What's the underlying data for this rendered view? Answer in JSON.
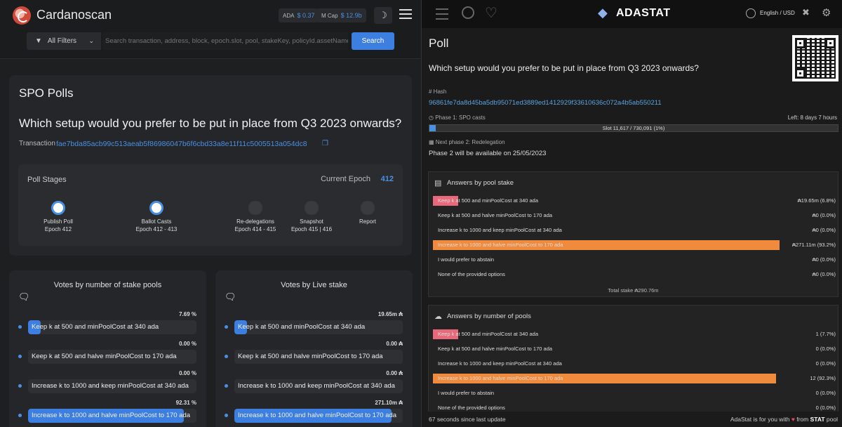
{
  "left": {
    "app_title": "Cardanoscan",
    "ada_label": "ADA",
    "ada_price": "$ 0.37",
    "mcap_label": "M Cap",
    "mcap_value": "$ 12.9b",
    "filter_label": "All Filters",
    "search_placeholder": "Search transaction, address, block, epoch.slot, pool, stakeKey, policyId.assetName",
    "search_button": "Search",
    "page_title": "SPO Polls",
    "question": "Which setup would you prefer to be put in place from Q3 2023 onwards?",
    "tx_label": "Transaction",
    "tx_hash": "fae7bda85acb99c513aeab5f86986047b6f6cbd33a8e11f11c5005513a054dc8",
    "stages_title": "Poll Stages",
    "current_epoch_label": "Current Epoch",
    "current_epoch": "412",
    "stages": [
      {
        "name": "Publish Poll",
        "epoch": "Epoch 412",
        "active": true
      },
      {
        "name": "Ballot Casts",
        "epoch": "Epoch 412 - 413",
        "active": true
      },
      {
        "name": "Re-delegations",
        "epoch": "Epoch 414 - 415",
        "active": false
      },
      {
        "name": "Snapshot",
        "epoch": "Epoch 415 | 416",
        "active": false
      },
      {
        "name": "Report",
        "epoch": "",
        "active": false
      }
    ],
    "votes_pools": {
      "title": "Votes by number of stake pools",
      "rows": [
        {
          "label": "Keep k at 500 and minPoolCost at 340 ada",
          "value": "7.69 %",
          "fraction": 0.0769
        },
        {
          "label": "Keep k at 500 and halve minPoolCost to 170 ada",
          "value": "0.00 %",
          "fraction": 0
        },
        {
          "label": "Increase k to 1000 and keep minPoolCost at 340 ada",
          "value": "0.00 %",
          "fraction": 0
        },
        {
          "label": "Increase k to 1000 and halve minPoolCost to 170 ada",
          "value": "92.31 %",
          "fraction": 0.9231
        }
      ]
    },
    "votes_stake": {
      "title": "Votes by Live stake",
      "rows": [
        {
          "label": "Keep k at 500 and minPoolCost at 340 ada",
          "value": "19.65m ₳",
          "fraction": 0.068
        },
        {
          "label": "Keep k at 500 and halve minPoolCost to 170 ada",
          "value": "0.00 ₳",
          "fraction": 0
        },
        {
          "label": "Increase k to 1000 and keep minPoolCost at 340 ada",
          "value": "0.00 ₳",
          "fraction": 0
        },
        {
          "label": "Increase k to 1000 and halve minPoolCost to 170 ada",
          "value": "271.10m ₳",
          "fraction": 0.932
        }
      ]
    }
  },
  "right": {
    "brand": "ADASTAT",
    "language": "English / USD",
    "page_title": "Poll",
    "question": "Which setup would you prefer to be put in place from Q3 2023 onwards?",
    "hash_label": "Hash",
    "hash": "96861fe7da8d45ba5db95071ed3889ed1412929f33610636c072a4b5ab550211",
    "phase1_label": "Phase 1: SPO casts",
    "time_left": "Left: 8 days 7 hours",
    "slot_text": "Slot 11,617 / 730,091 (1%)",
    "slot_fraction": 0.016,
    "phase2_label": "Next phase 2: Redelegation",
    "phase2_text": "Phase 2 will be available on 25/05/2023",
    "stake_panel": {
      "title": "Answers by pool stake",
      "rows": [
        {
          "label": "Keep k at 500 and minPoolCost at 340 ada",
          "value": "₳19.65m (6.8%)",
          "fraction": 0.068,
          "color": "#e8697a"
        },
        {
          "label": "Keep k at 500 and halve minPoolCost to 170 ada",
          "value": "₳0 (0.0%)",
          "fraction": 0,
          "color": "#e8697a"
        },
        {
          "label": "Increase k to 1000 and keep minPoolCost at 340 ada",
          "value": "₳0 (0.0%)",
          "fraction": 0,
          "color": "#e8697a"
        },
        {
          "label": "Increase k to 1000 and halve minPoolCost to 170 ada",
          "value": "₳271.11m (93.2%)",
          "fraction": 0.932,
          "color": "#f08a3c"
        },
        {
          "label": "I would prefer to abstain",
          "value": "₳0 (0.0%)",
          "fraction": 0,
          "color": "#e8697a"
        },
        {
          "label": "None of the provided options",
          "value": "₳0 (0.0%)",
          "fraction": 0,
          "color": "#e8697a"
        }
      ],
      "total": "Total stake ₳290.76m"
    },
    "pools_panel": {
      "title": "Answers by number of pools",
      "rows": [
        {
          "label": "Keep k at 500 and minPoolCost at 340 ada",
          "value": "1 (7.7%)",
          "fraction": 0.068,
          "color": "#e8697a"
        },
        {
          "label": "Keep k at 500 and halve minPoolCost to 170 ada",
          "value": "0 (0.0%)",
          "fraction": 0,
          "color": "#e8697a"
        },
        {
          "label": "Increase k to 1000 and keep minPoolCost at 340 ada",
          "value": "0 (0.0%)",
          "fraction": 0,
          "color": "#e8697a"
        },
        {
          "label": "Increase k to 1000 and halve minPoolCost to 170 ada",
          "value": "12 (92.3%)",
          "fraction": 0.923,
          "color": "#f08a3c"
        },
        {
          "label": "I would prefer to abstain",
          "value": "0 (0.0%)",
          "fraction": 0,
          "color": "#e8697a"
        },
        {
          "label": "None of the provided options",
          "value": "0 (0.0%)",
          "fraction": 0,
          "color": "#e8697a"
        }
      ]
    },
    "last_update": "67 seconds since last update",
    "footer_prefix": "AdaStat is for you with",
    "footer_from": "from",
    "footer_pool_name": "STAT",
    "footer_pool": "pool"
  }
}
